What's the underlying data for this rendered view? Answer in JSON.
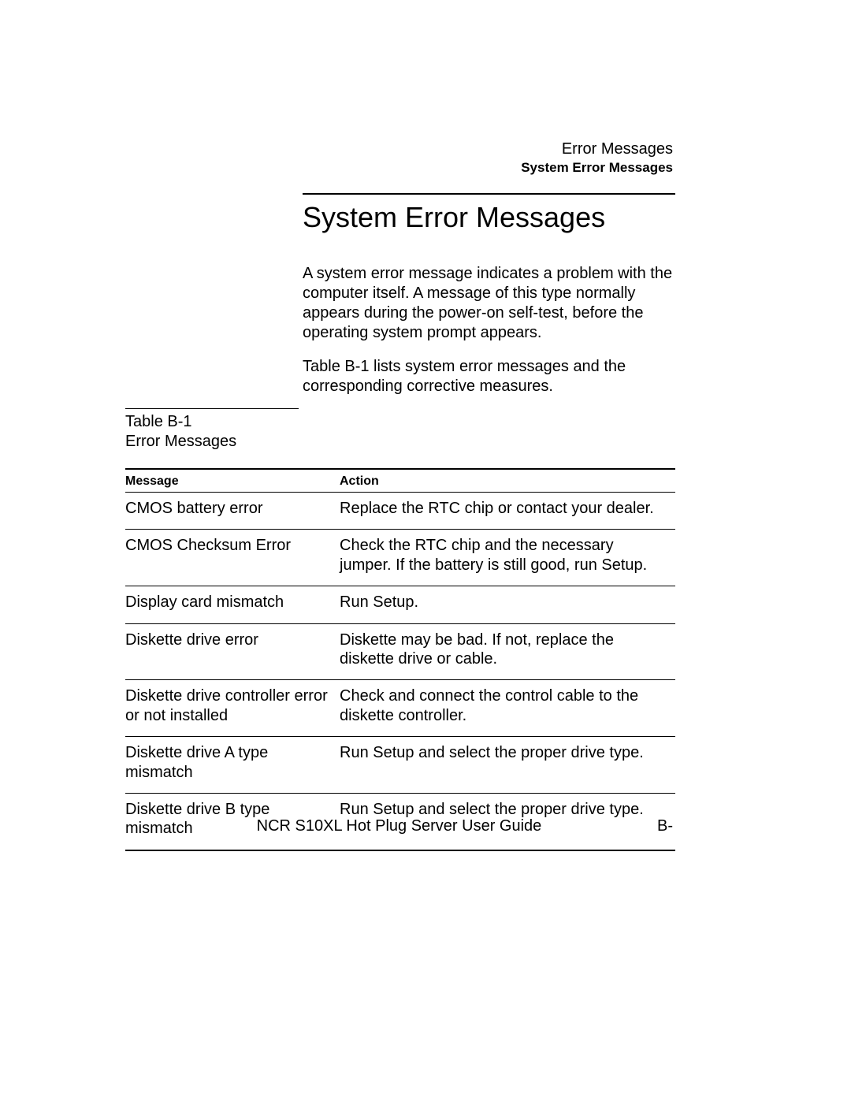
{
  "header": {
    "line1": "Error Messages",
    "line2": "System Error Messages"
  },
  "title": "System Error Messages",
  "intro": {
    "p1": "A system error message indicates a problem with the computer itself. A message of this type normally appears during the power-on self-test, before the operating system prompt appears.",
    "p2": "Table B-1 lists system error messages and the corresponding corrective measures."
  },
  "table_caption": {
    "label": "Table B-1",
    "title": "Error Messages"
  },
  "table": {
    "col1": "Message",
    "col2": "Action",
    "rows": [
      {
        "msg": "CMOS battery error",
        "act": "Replace the RTC chip or contact your dealer."
      },
      {
        "msg": "CMOS Checksum Error",
        "act": "Check the RTC chip and the necessary jumper. If the battery is still good, run Setup."
      },
      {
        "msg": "Display card mismatch",
        "act": "Run Setup."
      },
      {
        "msg": "Diskette drive error",
        "act": "Diskette may be bad. If not, replace the diskette drive or cable."
      },
      {
        "msg": "Diskette drive controller error or not installed",
        "act": "Check and connect the control cable to the diskette controller."
      },
      {
        "msg": "Diskette drive A type mismatch",
        "act": "Run Setup and select the proper drive type."
      },
      {
        "msg": "Diskette drive B type mismatch",
        "act": "Run Setup and select the proper drive type."
      }
    ]
  },
  "footer": {
    "title": "NCR S10XL Hot Plug Server User Guide",
    "page": "B-"
  }
}
